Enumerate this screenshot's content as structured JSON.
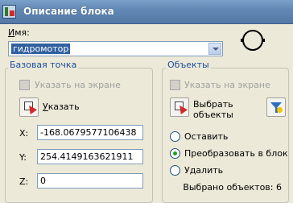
{
  "window": {
    "title": "Описание блока"
  },
  "name": {
    "label_ul": "И",
    "label_rest": "мя:",
    "value": "гидромотор"
  },
  "base_point": {
    "title": "Базовая точка",
    "specify_on_screen": "Указать на экране",
    "pick_label_ul": "У",
    "pick_label_rest": "казать",
    "x_label": "X:",
    "x_value": "-168.0679577106438",
    "y_label": "Y:",
    "y_value": "254.4149163621911",
    "z_label": "Z:",
    "z_value": "0"
  },
  "objects": {
    "title": "Объекты",
    "specify_on_screen": "Указать на экране",
    "select_line1": "Выбрать",
    "select_line2": "объекты",
    "retain": "Оставить",
    "convert": "Преобразовать в блок",
    "delete": "Удалить",
    "selected_count": "Выбрано объектов: 6",
    "selected_option": "convert"
  }
}
